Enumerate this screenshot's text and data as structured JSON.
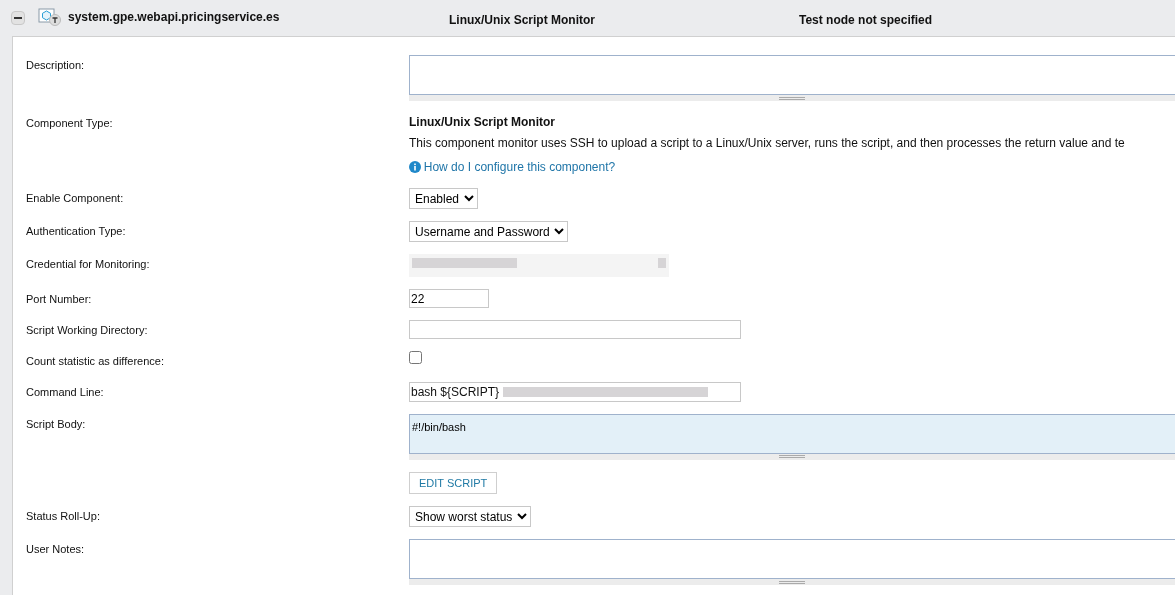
{
  "header": {
    "title": "system.gpe.webapi.pricingservice.es",
    "expanded": true,
    "monitor_type": "Linux/Unix Script Monitor",
    "test_node": "Test node not specified"
  },
  "fields": [
    {
      "kind": "textarea",
      "label": "Description:"
    },
    {
      "kind": "type_info",
      "label": "Component Type:",
      "type_name": "Linux/Unix Script Monitor",
      "description": "This component monitor uses SSH to upload a script to a Linux/Unix server, runs the script, and then processes the return value and te",
      "help_link": "How do I configure this component?"
    },
    {
      "kind": "select",
      "label": "Enable Component:",
      "value": "Enabled"
    },
    {
      "kind": "select",
      "label": "Authentication Type:",
      "value": "Username and Password"
    },
    {
      "kind": "redacted",
      "label": "Credential for Monitoring:"
    },
    {
      "kind": "short_input",
      "label": "Port Number:",
      "value": "22"
    },
    {
      "kind": "input",
      "label": "Script Working Directory:"
    },
    {
      "kind": "checkbox",
      "label": "Count statistic as difference:",
      "checked": false
    },
    {
      "kind": "command",
      "label": "Command Line:",
      "value": "bash ${SCRIPT}"
    },
    {
      "kind": "script",
      "label": "Script Body:",
      "value": "#!/bin/bash"
    },
    {
      "kind": "button",
      "label": "EDIT SCRIPT"
    },
    {
      "kind": "select",
      "label": "Status Roll-Up:",
      "value": "Show worst status"
    },
    {
      "kind": "textarea",
      "label": "User Notes:"
    }
  ]
}
